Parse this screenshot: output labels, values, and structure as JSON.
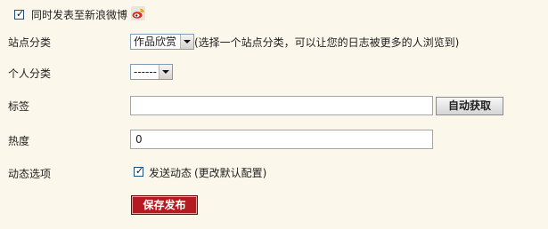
{
  "weibo_sync": {
    "checked": true,
    "label": "同时发表至新浪微博",
    "logo_icon": "weibo-icon"
  },
  "site_category": {
    "label": "站点分类",
    "selected": "作品欣赏",
    "hint": "(选择一个站点分类，可以让您的日志被更多的人浏览到)"
  },
  "personal_category": {
    "label": "个人分类",
    "selected": "------"
  },
  "tags": {
    "label": "标签",
    "value": "",
    "auto_button": "自动获取"
  },
  "heat": {
    "label": "热度",
    "value": "0"
  },
  "feed": {
    "label": "动态选项",
    "checked": true,
    "checkbox_label": "发送动态",
    "change_default_link": "(更改默认配置)"
  },
  "submit": {
    "label": "保存发布",
    "color": "#b51a20"
  }
}
